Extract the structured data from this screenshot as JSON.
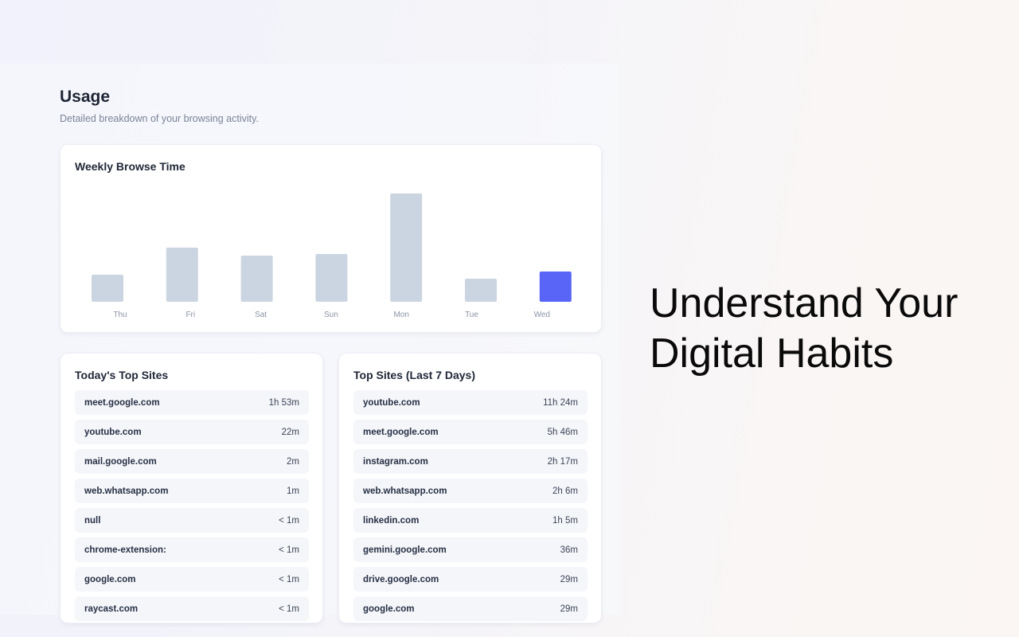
{
  "usage": {
    "title": "Usage",
    "subtitle": "Detailed breakdown of your browsing activity."
  },
  "weekly_chart": {
    "title": "Weekly Browse Time"
  },
  "chart_data": {
    "type": "bar",
    "title": "Weekly Browse Time",
    "categories": [
      "Thu",
      "Fri",
      "Sat",
      "Sun",
      "Mon",
      "Tue",
      "Wed"
    ],
    "values": [
      34,
      68,
      58,
      60,
      136,
      29,
      38
    ],
    "highlight_index": 6,
    "ylim": [
      0,
      136
    ],
    "grid": false,
    "bar_color": "#cbd5e1",
    "highlight_color": "#5865f6",
    "xlabel": "",
    "ylabel": ""
  },
  "today_sites": {
    "title": "Today's Top Sites",
    "items": [
      {
        "site": "meet.google.com",
        "time": "1h 53m"
      },
      {
        "site": "youtube.com",
        "time": "22m"
      },
      {
        "site": "mail.google.com",
        "time": "2m"
      },
      {
        "site": "web.whatsapp.com",
        "time": "1m"
      },
      {
        "site": "null",
        "time": "< 1m"
      },
      {
        "site": "chrome-extension:",
        "time": "< 1m"
      },
      {
        "site": "google.com",
        "time": "< 1m"
      },
      {
        "site": "raycast.com",
        "time": "< 1m"
      }
    ]
  },
  "week_sites": {
    "title": "Top Sites (Last 7 Days)",
    "items": [
      {
        "site": "youtube.com",
        "time": "11h 24m"
      },
      {
        "site": "meet.google.com",
        "time": "5h 46m"
      },
      {
        "site": "instagram.com",
        "time": "2h 17m"
      },
      {
        "site": "web.whatsapp.com",
        "time": "2h 6m"
      },
      {
        "site": "linkedin.com",
        "time": "1h 5m"
      },
      {
        "site": "gemini.google.com",
        "time": "36m"
      },
      {
        "site": "drive.google.com",
        "time": "29m"
      },
      {
        "site": "google.com",
        "time": "29m"
      }
    ]
  },
  "headline": {
    "line1": "Understand Your",
    "line2": "Digital Habits"
  }
}
